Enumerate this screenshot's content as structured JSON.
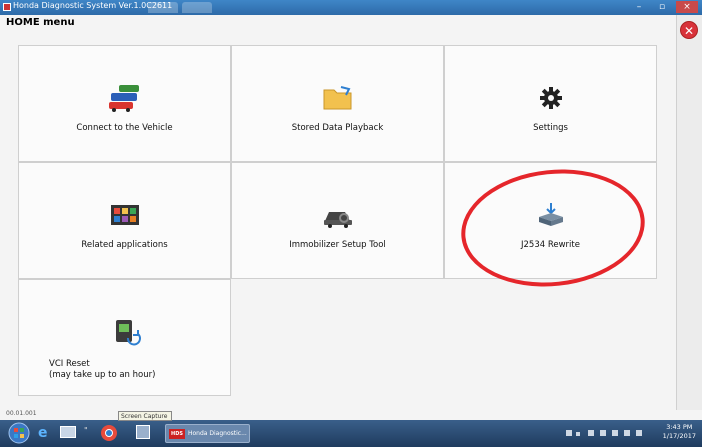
{
  "window": {
    "title": "Honda Diagnostic System Ver.1.0C2611"
  },
  "header": {
    "title": "HOME menu"
  },
  "tiles": [
    {
      "label": "Connect to the Vehicle"
    },
    {
      "label": "Stored Data Playback"
    },
    {
      "label": "Settings"
    },
    {
      "label": "Related applications"
    },
    {
      "label": "Immobilizer Setup Tool"
    },
    {
      "label": "J2534 Rewrite"
    },
    {
      "label_line1": "VCI Reset",
      "label_line2": "(may take up to an hour)"
    }
  ],
  "status": {
    "left_text": "00.01.001"
  },
  "taskbar": {
    "tooltip": "Screen Capture",
    "app_badge": "HDS",
    "app_label": "Honda Diagnostic...",
    "time": "3:43 PM",
    "date": "1/17/2017"
  },
  "icons": {
    "close": "close-icon",
    "settings": "gear-icon",
    "folder": "folder-icon",
    "cars": "vehicles-icon",
    "apps": "apps-grid-icon",
    "immobilizer": "car-key-icon",
    "rewrite": "ecu-download-icon",
    "vci": "vci-device-icon"
  },
  "colors": {
    "highlight_circle": "#e5262b",
    "close_button": "#d8323a"
  }
}
